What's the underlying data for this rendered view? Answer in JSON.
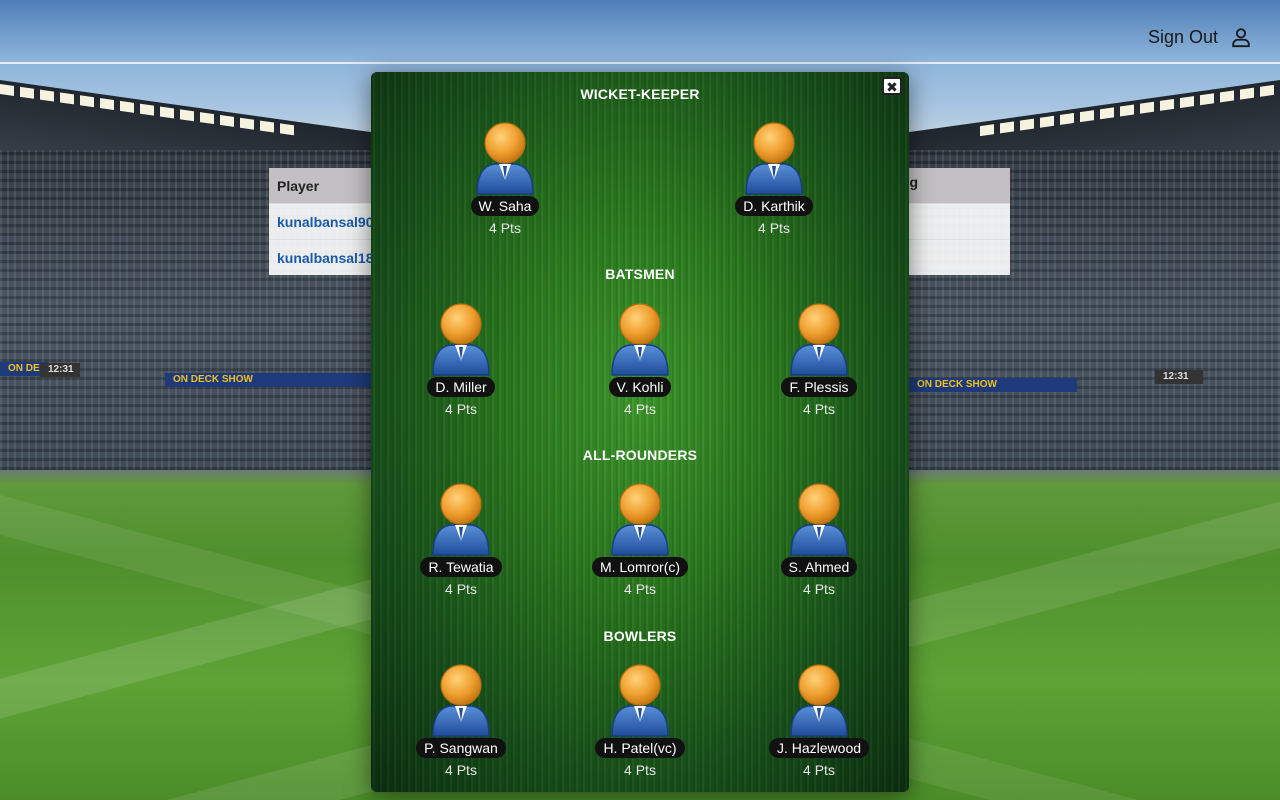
{
  "header": {
    "sign_out": "Sign Out"
  },
  "background_table": {
    "header_player": "Player",
    "header_right": "g",
    "rows": [
      "kunalbansal90",
      "kunalbansal18"
    ]
  },
  "stadium_banners": [
    "ON DECK SHOW",
    "ON DECK SHOW",
    "ON DECK SHOW",
    "12:31",
    "12:31"
  ],
  "modal": {
    "close": "✖",
    "sections": {
      "wk": "WICKET-KEEPER",
      "bat": "BATSMEN",
      "ar": "ALL-ROUNDERS",
      "bowl": "BOWLERS"
    },
    "players": {
      "wk": [
        {
          "name": "W. Saha",
          "pts": "4 Pts"
        },
        {
          "name": "D. Karthik",
          "pts": "4 Pts"
        }
      ],
      "bat": [
        {
          "name": "D. Miller",
          "pts": "4 Pts"
        },
        {
          "name": "V. Kohli",
          "pts": "4 Pts"
        },
        {
          "name": "F. Plessis",
          "pts": "4 Pts"
        }
      ],
      "ar": [
        {
          "name": "R. Tewatia",
          "pts": "4 Pts"
        },
        {
          "name": "M. Lomror(c)",
          "pts": "4 Pts"
        },
        {
          "name": "S. Ahmed",
          "pts": "4 Pts"
        }
      ],
      "bowl": [
        {
          "name": "P. Sangwan",
          "pts": "4 Pts"
        },
        {
          "name": "H. Patel(vc)",
          "pts": "4 Pts"
        },
        {
          "name": "J. Hazlewood",
          "pts": "4 Pts"
        }
      ]
    }
  },
  "colors": {
    "avatar_head": "#f0a030",
    "avatar_body": "#2f62b0",
    "link": "#1a5aa8",
    "name_pill": "#111111"
  }
}
